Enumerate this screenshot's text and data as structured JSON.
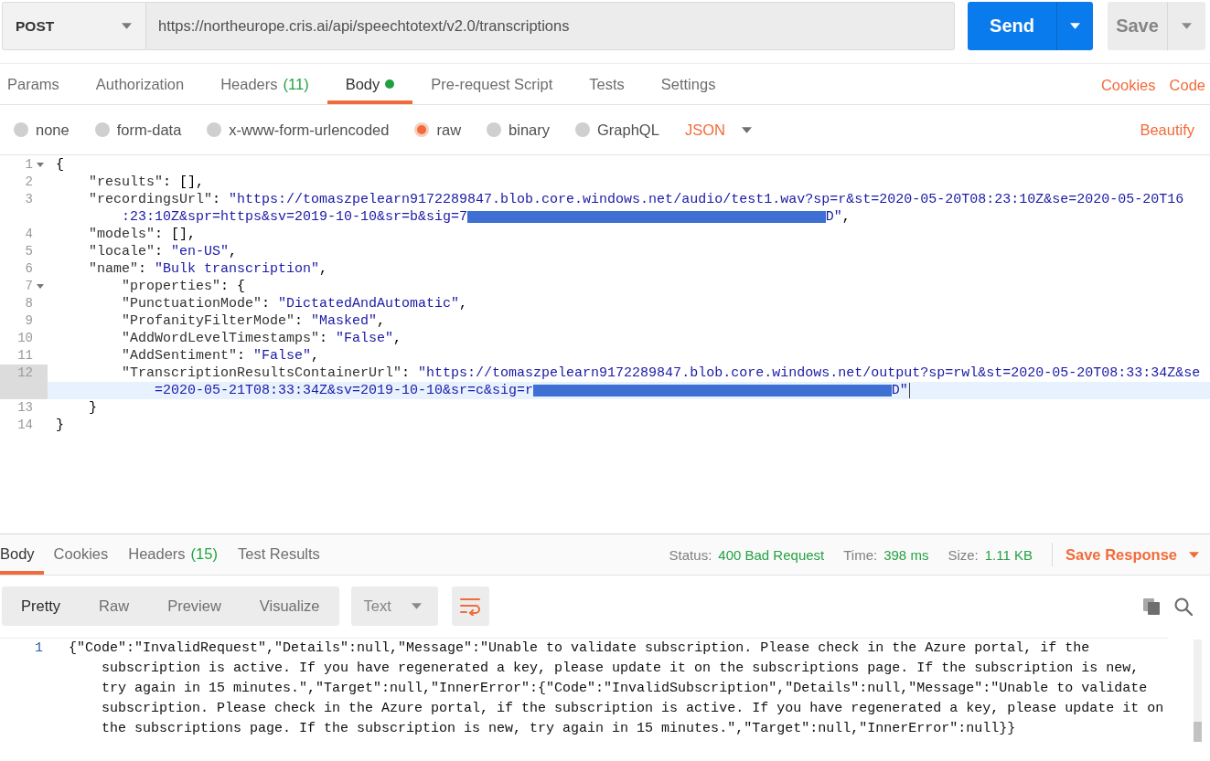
{
  "request_bar": {
    "method": "POST",
    "url": "https://northeurope.cris.ai/api/speechtotext/v2.0/transcriptions",
    "send_label": "Send",
    "save_label": "Save"
  },
  "request_tabs": [
    {
      "label": "Params",
      "selected": false,
      "dot": false
    },
    {
      "label": "Authorization",
      "selected": false,
      "dot": false
    },
    {
      "label": "Headers",
      "count": "(11)",
      "selected": false,
      "dot": false
    },
    {
      "label": "Body",
      "selected": true,
      "dot": true
    },
    {
      "label": "Pre-request Script",
      "selected": false,
      "dot": false
    },
    {
      "label": "Tests",
      "selected": false,
      "dot": false
    },
    {
      "label": "Settings",
      "selected": false,
      "dot": false
    }
  ],
  "request_links": [
    "Cookies",
    "Code"
  ],
  "body_types": [
    {
      "label": "none",
      "selected": false
    },
    {
      "label": "form-data",
      "selected": false
    },
    {
      "label": "x-www-form-urlencoded",
      "selected": false
    },
    {
      "label": "raw",
      "selected": true
    },
    {
      "label": "binary",
      "selected": false
    },
    {
      "label": "GraphQL",
      "selected": false
    }
  ],
  "raw_format": "JSON",
  "beautify": "Beautify",
  "editor": {
    "lines": [
      {
        "number": "1",
        "foldable": true,
        "active": false,
        "rows": [
          [
            {
              "kind": "punct",
              "text": "{"
            }
          ]
        ]
      },
      {
        "number": "2",
        "foldable": false,
        "active": false,
        "rows": [
          [
            {
              "kind": "key",
              "text": "    \"results\""
            },
            {
              "kind": "punct",
              "text": ": [],"
            }
          ]
        ]
      },
      {
        "number": "3",
        "foldable": false,
        "active": false,
        "rows": [
          [
            {
              "kind": "key",
              "text": "    \"recordingsUrl\""
            },
            {
              "kind": "punct",
              "text": ": "
            },
            {
              "kind": "string",
              "text": "\"https://tomaszpelearn9172289847.blob.core.windows.net/audio/test1.wav?sp=r&st=2020-05-20T08:23:10Z&se=2020-05-20T16"
            }
          ],
          [
            {
              "kind": "string",
              "text": ":23:10Z&spr=https&sv=2019-10-10&sr=b&sig=7"
            },
            {
              "kind": "redacted"
            },
            {
              "kind": "string",
              "text": "D\""
            },
            {
              "kind": "punct",
              "text": ","
            }
          ]
        ]
      },
      {
        "number": "4",
        "foldable": false,
        "active": false,
        "rows": [
          [
            {
              "kind": "key",
              "text": "    \"models\""
            },
            {
              "kind": "punct",
              "text": ": [],"
            }
          ]
        ]
      },
      {
        "number": "5",
        "foldable": false,
        "active": false,
        "rows": [
          [
            {
              "kind": "key",
              "text": "    \"locale\""
            },
            {
              "kind": "punct",
              "text": ": "
            },
            {
              "kind": "string",
              "text": "\"en-US\""
            },
            {
              "kind": "punct",
              "text": ","
            }
          ]
        ]
      },
      {
        "number": "6",
        "foldable": false,
        "active": false,
        "rows": [
          [
            {
              "kind": "key",
              "text": "    \"name\""
            },
            {
              "kind": "punct",
              "text": ": "
            },
            {
              "kind": "string",
              "text": "\"Bulk transcription\""
            },
            {
              "kind": "punct",
              "text": ","
            }
          ]
        ]
      },
      {
        "number": "7",
        "foldable": true,
        "active": false,
        "rows": [
          [
            {
              "kind": "key",
              "text": "        \"properties\""
            },
            {
              "kind": "punct",
              "text": ": {"
            }
          ]
        ]
      },
      {
        "number": "8",
        "foldable": false,
        "active": false,
        "rows": [
          [
            {
              "kind": "key",
              "text": "        \"PunctuationMode\""
            },
            {
              "kind": "punct",
              "text": ": "
            },
            {
              "kind": "string",
              "text": "\"DictatedAndAutomatic\""
            },
            {
              "kind": "punct",
              "text": ","
            }
          ]
        ]
      },
      {
        "number": "9",
        "foldable": false,
        "active": false,
        "rows": [
          [
            {
              "kind": "key",
              "text": "        \"ProfanityFilterMode\""
            },
            {
              "kind": "punct",
              "text": ": "
            },
            {
              "kind": "string",
              "text": "\"Masked\""
            },
            {
              "kind": "punct",
              "text": ","
            }
          ]
        ]
      },
      {
        "number": "10",
        "foldable": false,
        "active": false,
        "rows": [
          [
            {
              "kind": "key",
              "text": "        \"AddWordLevelTimestamps\""
            },
            {
              "kind": "punct",
              "text": ": "
            },
            {
              "kind": "string",
              "text": "\"False\""
            },
            {
              "kind": "punct",
              "text": ","
            }
          ]
        ]
      },
      {
        "number": "11",
        "foldable": false,
        "active": false,
        "rows": [
          [
            {
              "kind": "key",
              "text": "        \"AddSentiment\""
            },
            {
              "kind": "punct",
              "text": ": "
            },
            {
              "kind": "string",
              "text": "\"False\""
            },
            {
              "kind": "punct",
              "text": ","
            }
          ]
        ]
      },
      {
        "number": "12",
        "foldable": false,
        "active": true,
        "rows": [
          [
            {
              "kind": "key",
              "text": "        \"TranscriptionResultsContainerUrl\""
            },
            {
              "kind": "punct",
              "text": ": "
            },
            {
              "kind": "string",
              "text": "\"https://tomaszpelearn9172289847.blob.core.windows.net/output?sp=rwl&st=2020-05-20T08:33:34Z&se"
            }
          ],
          [
            {
              "kind": "string",
              "text": "=2020-05-21T08:33:34Z&sv=2019-10-10&sr=c&sig=r"
            },
            {
              "kind": "redacted"
            },
            {
              "kind": "string",
              "text": "D\""
            }
          ]
        ]
      },
      {
        "number": "13",
        "foldable": false,
        "active": false,
        "rows": [
          [
            {
              "kind": "punct",
              "text": "    }"
            }
          ]
        ]
      },
      {
        "number": "14",
        "foldable": false,
        "active": false,
        "rows": [
          [
            {
              "kind": "punct",
              "text": "}"
            }
          ]
        ]
      }
    ]
  },
  "response_tabs": [
    {
      "label": "Body",
      "selected": true
    },
    {
      "label": "Cookies",
      "selected": false
    },
    {
      "label": "Headers",
      "count": "(15)",
      "selected": false
    },
    {
      "label": "Test Results",
      "selected": false
    }
  ],
  "response_meta": [
    {
      "label": "Status:",
      "value": "400 Bad Request"
    },
    {
      "label": "Time:",
      "value": "398 ms"
    },
    {
      "label": "Size:",
      "value": "1.11 KB"
    }
  ],
  "save_response": "Save Response",
  "response_toolbar": {
    "view_modes": [
      {
        "label": "Pretty",
        "selected": true
      },
      {
        "label": "Raw",
        "selected": false
      },
      {
        "label": "Preview",
        "selected": false
      },
      {
        "label": "Visualize",
        "selected": false
      }
    ],
    "format": "Text",
    "wrap_lines": true
  },
  "response_body": {
    "lines": [
      {
        "number": "1",
        "text": "{\"Code\":\"InvalidRequest\",\"Details\":null,\"Message\":\"Unable to validate subscription. Please check in the Azure portal, if the subscription is active. If you have regenerated a key, please update it on the subscriptions page. If the subscription is new, try again in 15 minutes.\",\"Target\":null,\"InnerError\":{\"Code\":\"InvalidSubscription\",\"Details\":null,\"Message\":\"Unable to validate subscription. Please check in the Azure portal, if the subscription is active. If you have regenerated a key, please update it on the subscriptions page. If the subscription is new, try again in 15 minutes.\",\"Target\":null,\"InnerError\":null}}"
      }
    ]
  }
}
